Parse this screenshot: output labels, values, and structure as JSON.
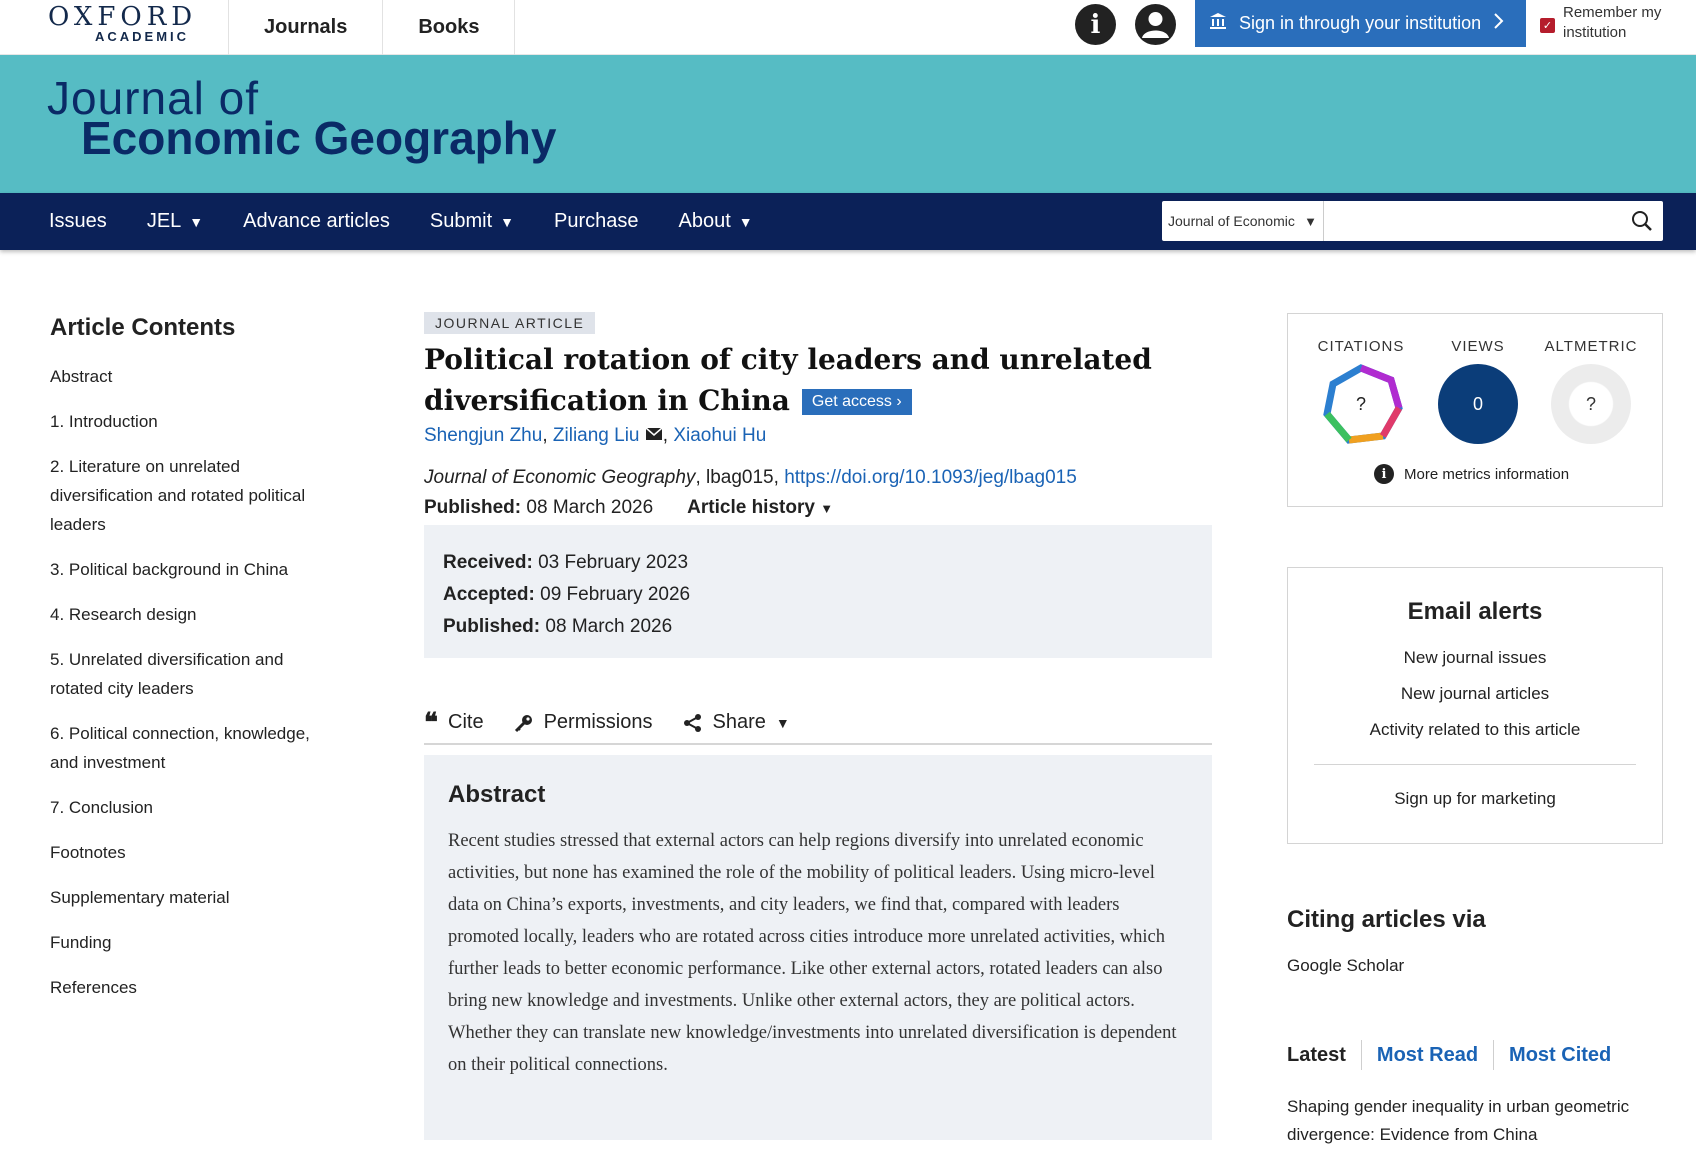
{
  "topbar": {
    "logo_oxford": "OXFORD",
    "logo_academic": "ACADEMIC",
    "nav": [
      "Journals",
      "Books"
    ],
    "signin": "Sign in through your institution",
    "remember": "Remember my institution"
  },
  "banner": {
    "line1": "Journal of",
    "line2": "Economic Geography"
  },
  "mainnav": {
    "issues": "Issues",
    "jel": "JEL",
    "advance": "Advance articles",
    "submit": "Submit",
    "purchase": "Purchase",
    "about": "About",
    "search_scope": "Journal of Economic",
    "search_placeholder": ""
  },
  "toc": {
    "title": "Article Contents",
    "items": [
      "Abstract",
      "1. Introduction",
      "2. Literature on unrelated diversification and rotated political leaders",
      "3. Political background in China",
      "4. Research design",
      "5. Unrelated diversification and rotated city leaders",
      "6. Political connection, knowledge, and investment",
      "7. Conclusion",
      "Footnotes",
      "Supplementary material",
      "Funding",
      "References"
    ]
  },
  "article": {
    "badge": "JOURNAL ARTICLE",
    "title": "Political rotation of city leaders and unrelated diversification in China",
    "get_access": "Get access",
    "author1": "Shengjun Zhu",
    "author2": "Ziliang Liu",
    "author3": "Xiaohui Hu",
    "journal": "Journal of Economic Geography",
    "article_id": ", lbag015, ",
    "doi": "https://doi.org/10.1093/jeg/lbag015",
    "published_label": "Published:",
    "published_date": "08 March 2026",
    "history_label": "Article history",
    "received_label": "Received:",
    "received_date": "03 February 2023",
    "accepted_label": "Accepted:",
    "accepted_date": "09 February 2026",
    "published2_label": "Published:",
    "published2_date": "08 March 2026",
    "cite": "Cite",
    "permissions": "Permissions",
    "share": "Share",
    "abstract_title": "Abstract",
    "abstract_text": "Recent studies stressed that external actors can help regions diversify into unrelated economic activities, but none has examined the role of the mobility of political leaders. Using micro-level data on China’s exports, investments, and city leaders, we find that, compared with leaders promoted locally, leaders who are rotated across cities introduce more unrelated activities, which further leads to better economic performance. Like other external actors, rotated leaders can also bring new knowledge and investments. Unlike other external actors, they are political actors. Whether they can translate new knowledge/investments into unrelated diversification is dependent on their political connections."
  },
  "metrics": {
    "citations_label": "CITATIONS",
    "citations_value": "?",
    "views_label": "VIEWS",
    "views_value": "0",
    "altmetric_label": "ALTMETRIC",
    "altmetric_value": "?",
    "more": "More metrics information"
  },
  "alerts": {
    "title": "Email alerts",
    "items": [
      "New journal issues",
      "New journal articles",
      "Activity related to this article"
    ],
    "marketing": "Sign up for marketing"
  },
  "citing": {
    "title": "Citing articles via",
    "scholar": "Google Scholar"
  },
  "tabs": [
    "Latest",
    "Most Read",
    "Most Cited"
  ],
  "latest_item": "Shaping gender inequality in urban geometric divergence: Evidence from China"
}
